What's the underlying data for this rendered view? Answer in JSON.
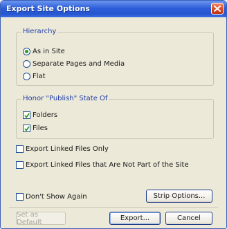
{
  "dialog": {
    "title": "Export Site Options"
  },
  "hierarchy": {
    "legend": "Hierarchy",
    "options": [
      "As in Site",
      "Separate Pages and Media",
      "Flat"
    ],
    "selected_index": 0
  },
  "publish": {
    "legend": "Honor \"Publish\" State Of",
    "folders_label": "Folders",
    "files_label": "Files",
    "folders_checked": true,
    "files_checked": true
  },
  "export_linked_only_label": "Export Linked Files Only",
  "export_linked_not_part_label": "Export Linked Files that Are Not Part of the Site",
  "dont_show_again_label": "Don't Show Again",
  "buttons": {
    "strip_options": "Strip Options...",
    "set_as_default": "Set as Default",
    "export": "Export...",
    "cancel": "Cancel"
  },
  "colors": {
    "title_bar": "#2556d0",
    "close_button": "#d8431e",
    "legend_text": "#1f3ea8",
    "face": "#ece9d8"
  }
}
